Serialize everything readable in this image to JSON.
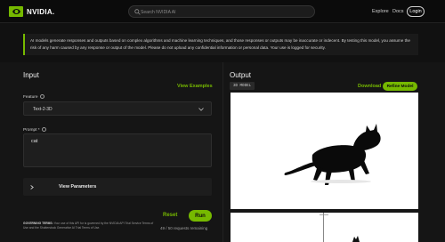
{
  "header": {
    "brand": "NVIDIA.",
    "search_placeholder": "Search NVIDIA AI",
    "nav": {
      "explore": "Explore",
      "docs": "Docs",
      "login": "Login"
    }
  },
  "disclaimer": "AI models generate responses and outputs based on complex algorithms and machine learning techniques, and those responses or outputs may be inaccurate or indecent. By testing this model, you assume the risk of any harm caused by any response or output of the model. Please do not upload any confidential information or personal data. Your use is logged for security.",
  "input_panel": {
    "title": "Input",
    "view_examples": "View Examples",
    "feature_label": "Feature",
    "feature_value": "Text-2-3D",
    "prompt_label": "Prompt *",
    "prompt_value": "cat",
    "view_parameters": "View Parameters",
    "terms_bold": "GOVERNING TERMS:",
    "terms_text": "Your use of this API for is governed by the NVIDIA API Trial Service Terms of Use and the Shutterstock Generative AI Trial Terms of Use.",
    "reset_label": "Reset",
    "run_label": "Run",
    "requests_remaining": "49 / 50 requests remaining"
  },
  "output_panel": {
    "title": "Output",
    "model_badge": "3D MODEL",
    "download_label": "Download",
    "refine_label": "Refine Model"
  },
  "colors": {
    "accent": "#76b900",
    "background": "#111111",
    "panel": "#151515",
    "viewer_bg": "#ffffff"
  },
  "icons": [
    "nvidia-logo-icon",
    "search-icon",
    "info-icon",
    "chevron-down-icon",
    "chevron-right-icon",
    "cat-model-icon"
  ]
}
